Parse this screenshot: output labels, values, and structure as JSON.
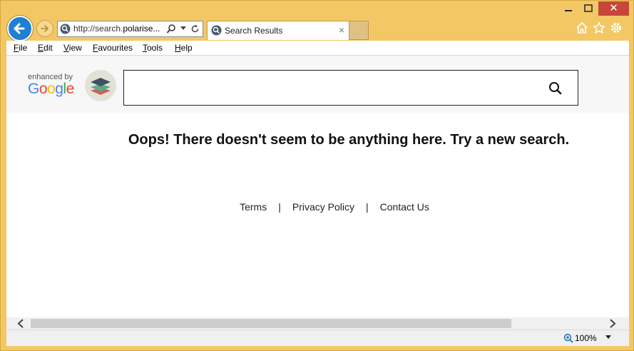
{
  "browser": {
    "address_url_prefix": "http://search.",
    "address_url_domain": "polarise...",
    "tab_title": "Search Results",
    "tab_close": "×",
    "close_glyph": "✕"
  },
  "menu": {
    "items": [
      "File",
      "Edit",
      "View",
      "Favourites",
      "Tools",
      "Help"
    ]
  },
  "page": {
    "enhanced_by": "enhanced by",
    "google_letters": [
      "G",
      "o",
      "o",
      "g",
      "l",
      "e"
    ],
    "google_colors": [
      "#4285F4",
      "#EA4335",
      "#FBBC05",
      "#4285F4",
      "#34A853",
      "#EA4335"
    ],
    "search_value": "",
    "message": "Oops! There doesn't seem to be anything here. Try a new search.",
    "footer": {
      "terms": "Terms",
      "separator": "|",
      "privacy": "Privacy Policy",
      "contact": "Contact Us"
    }
  },
  "status": {
    "zoom": "100%"
  },
  "colors": {
    "frame": "#f3c864",
    "back_button": "#1f7fd3",
    "close_button": "#c7463a"
  }
}
